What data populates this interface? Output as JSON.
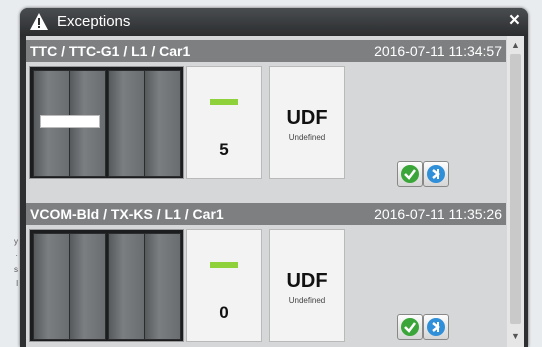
{
  "window": {
    "title": "Exceptions",
    "close_label": "×"
  },
  "exceptions": [
    {
      "name": "TTC / TTC-G1 / L1 / Car1",
      "timestamp": "2016-07-11 11:34:57",
      "count": "5",
      "status_code": "UDF",
      "status_text": "Undefined"
    },
    {
      "name": "VCOM-Bld / TX-KS / L1 / Car1",
      "timestamp": "2016-07-11 11:35:26",
      "count": "0",
      "status_code": "UDF",
      "status_text": "Undefined"
    }
  ],
  "icons": {
    "title": "warning-icon",
    "acknowledge": "check-icon",
    "navigate": "go-to-icon"
  },
  "colors": {
    "accent_green": "#8fd13a",
    "ack_green": "#3aa63a",
    "nav_blue": "#2f8fd8"
  }
}
